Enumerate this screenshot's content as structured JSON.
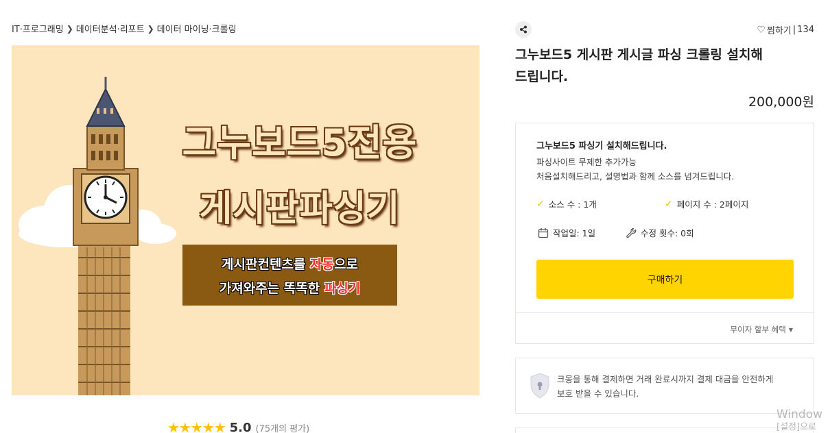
{
  "breadcrumb": {
    "items": [
      "IT·프로그래밍",
      "데이터분석·리포트",
      "데이터 마이닝·크롤링"
    ],
    "separator": "›"
  },
  "hero": {
    "headline_1": "그누보드5전용",
    "headline_2": "게시판파싱기",
    "box_line1_a": "게시판컨텐츠를 ",
    "box_line1_red": "자동",
    "box_line1_b": "으로",
    "box_line2_a": "가져와주는 똑똑한 ",
    "box_line2_red": "파싱기",
    "colors": {
      "background": "#fde5bd",
      "box": "#8b5a12",
      "highlight": "#ff2a2a"
    }
  },
  "rating": {
    "stars": 5,
    "max_stars": 5,
    "score": "5.0",
    "count": "(75개의 평가)"
  },
  "actions": {
    "share_icon": "share-icon",
    "wish_label": "찜하기",
    "wish_count": "134"
  },
  "product": {
    "title_line1": "그누보드5 게시판 게시글 파싱 크롤링 설치해",
    "title_line2": "드립니다.",
    "price": "200,000원"
  },
  "option": {
    "title": "그누보드5 파싱기 설치해드립니다.",
    "desc_line1": "파싱사이트 무제한 추가가능",
    "desc_line2": "처음설치해드리고, 설명법과 함께 소스를 넘겨드립니다.",
    "features": {
      "source_count": "소스 수 : 1개",
      "page_count": "페이지 수 : 2페이지",
      "work_days": "작업일: 1일",
      "revisions": "수정 횟수: 0회"
    },
    "buy_label": "구매하기",
    "installment_label": "무이자 할부 혜택",
    "accent_color": "#ffd400"
  },
  "safe": {
    "line1": "크몽을 통해 결제하면 거래 완료시까지 결제 대금을 안전하게",
    "line2": "보호 받을 수 있습니다."
  },
  "watermark": {
    "line1": "Window",
    "line2": "[설정]으로"
  }
}
